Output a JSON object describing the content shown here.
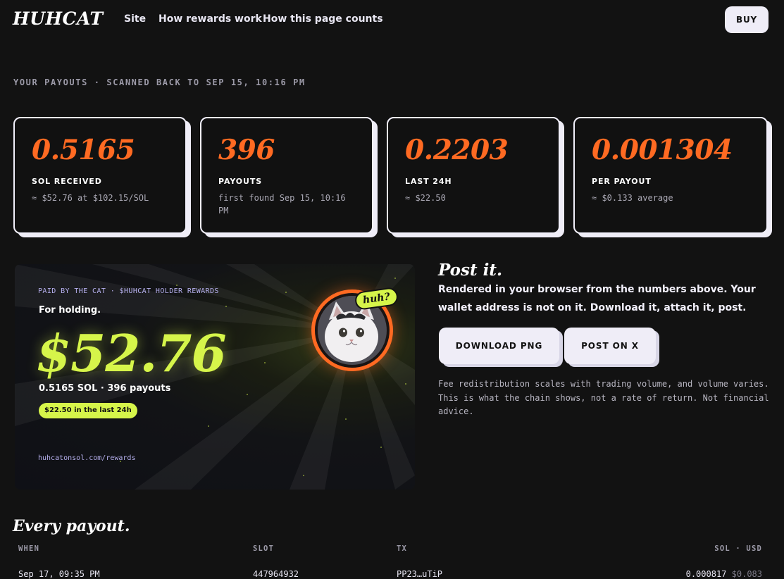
{
  "nav": {
    "logo": "HUHCAT",
    "links": [
      "Site",
      "How rewards work",
      "How this page counts"
    ],
    "buy_label": "BUY"
  },
  "scan_line": "YOUR PAYOUTS · SCANNED BACK TO SEP 15, 10:16 PM",
  "stats": [
    {
      "value": "0.5165",
      "label": "SOL RECEIVED",
      "sub": "≈ $52.76 at $102.15/SOL"
    },
    {
      "value": "396",
      "label": "PAYOUTS",
      "sub": "first found Sep 15, 10:16 PM"
    },
    {
      "value": "0.2203",
      "label": "LAST 24H",
      "sub": "≈ $22.50"
    },
    {
      "value": "0.001304",
      "label": "PER PAYOUT",
      "sub": "≈ $0.133 average"
    }
  ],
  "card": {
    "kicker": "PAID BY THE CAT · $HUHCAT HOLDER REWARDS",
    "holding": "For holding.",
    "amount": "$52.76",
    "sol_line": "0.5165 SOL · 396 payouts",
    "pill": "$22.50 in the last 24h",
    "url": "huhcatonsol.com/rewards",
    "bubble": "huh?"
  },
  "post": {
    "title": "Post it.",
    "description": "Rendered in your browser from the numbers above. Your wallet address is not on it. Download it, attach it, post.",
    "download_label": "DOWNLOAD PNG",
    "post_x_label": "POST ON X",
    "note": "Fee redistribution scales with trading volume, and volume varies. This is what the chain shows, not a rate of return. Not financial advice."
  },
  "table": {
    "title": "Every payout.",
    "headers": {
      "when": "WHEN",
      "slot": "SLOT",
      "tx": "TX",
      "amount": "SOL · USD"
    },
    "rows": [
      {
        "when": "Sep 17, 09:35 PM",
        "slot": "447964932",
        "tx": "PP23…uTiP",
        "sol": "0.000817",
        "usd": "$0.083"
      }
    ]
  },
  "colors": {
    "accent_orange": "#ff6a22",
    "accent_lime": "#d6f54a",
    "background": "#121212",
    "lavender": "#b6b0ee"
  }
}
